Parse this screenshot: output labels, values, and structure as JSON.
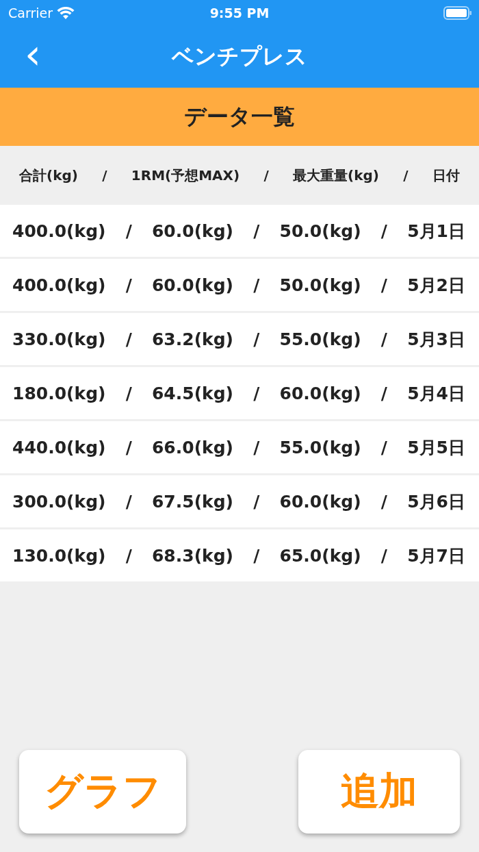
{
  "status_bar": {
    "carrier": "Carrier",
    "time": "9:55 PM"
  },
  "nav_bar": {
    "back": "‹",
    "title": "ベンチプレス"
  },
  "section_header": {
    "title": "データ一覧"
  },
  "table": {
    "columns": [
      "合計(kg)",
      "/",
      "1RM(予想MAX)",
      "/",
      "最大重量(kg)",
      "/",
      "日付"
    ],
    "rows": [
      [
        "400.0(kg)",
        "/",
        "60.0(kg)",
        "/",
        "50.0(kg)",
        "/",
        "5月1日"
      ],
      [
        "400.0(kg)",
        "/",
        "60.0(kg)",
        "/",
        "50.0(kg)",
        "/",
        "5月2日"
      ],
      [
        "330.0(kg)",
        "/",
        "63.2(kg)",
        "/",
        "55.0(kg)",
        "/",
        "5月3日"
      ],
      [
        "180.0(kg)",
        "/",
        "64.5(kg)",
        "/",
        "60.0(kg)",
        "/",
        "5月4日"
      ],
      [
        "440.0(kg)",
        "/",
        "66.0(kg)",
        "/",
        "55.0(kg)",
        "/",
        "5月5日"
      ],
      [
        "300.0(kg)",
        "/",
        "67.5(kg)",
        "/",
        "60.0(kg)",
        "/",
        "5月6日"
      ],
      [
        "130.0(kg)",
        "/",
        "68.3(kg)",
        "/",
        "65.0(kg)",
        "/",
        "5月7日"
      ]
    ]
  },
  "buttons": [
    {
      "label": "グラフ"
    },
    {
      "label": "追加"
    }
  ]
}
